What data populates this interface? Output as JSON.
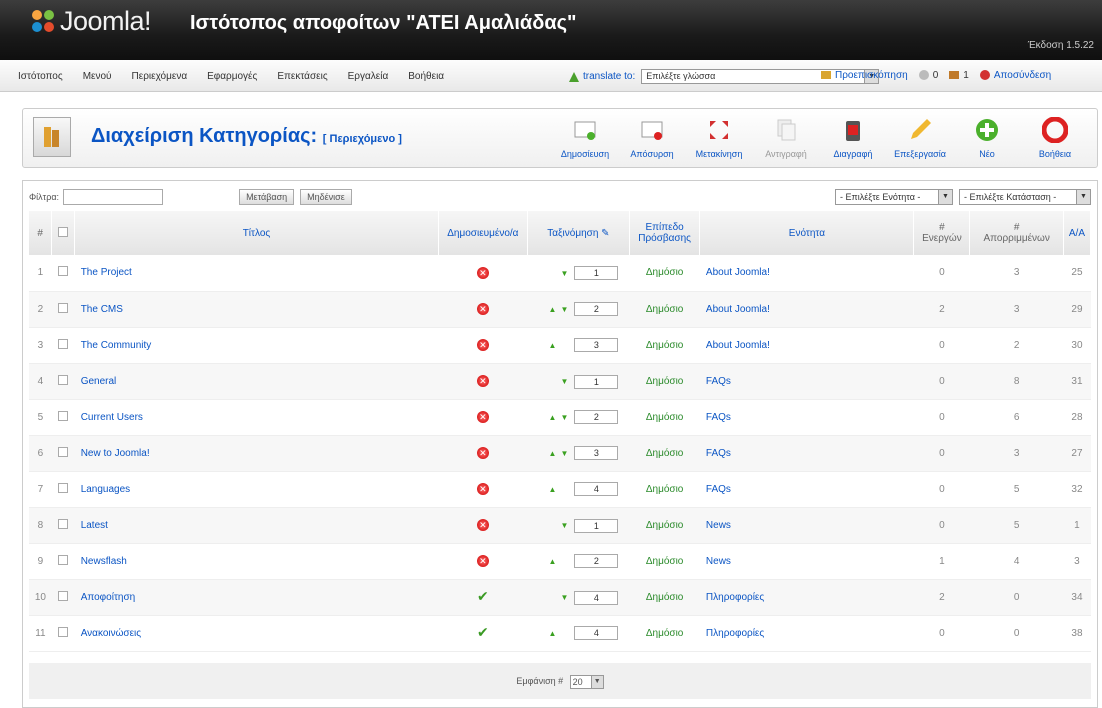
{
  "header": {
    "logo_text": "Joomla!",
    "site_title": "Ιστότοπος αποφοίτων \"ΑΤΕΙ Αμαλιάδας\"",
    "version": "Έκδοση 1.5.22"
  },
  "menu": {
    "items": [
      "Ιστότοπος",
      "Μενού",
      "Περιεχόμενα",
      "Εφαρμογές",
      "Επεκτάσεις",
      "Εργαλεία",
      "Βοήθεια"
    ],
    "translate_label": "translate to:",
    "translate_select": "Επιλέξτε γλώσσα",
    "preview": "Προεπισκόπηση",
    "messages_count": "0",
    "users_count": "1",
    "logout": "Αποσύνδεση"
  },
  "toolbar": {
    "title": "Διαχείριση Κατηγορίας:",
    "subtitle": "[ Περιεχόμενο ]",
    "buttons": {
      "publish": "Δημοσίευση",
      "unpublish": "Απόσυρση",
      "move": "Μετακίνηση",
      "copy": "Αντιγραφή",
      "delete": "Διαγραφή",
      "edit": "Επεξεργασία",
      "new": "Νέο",
      "help": "Βοήθεια"
    }
  },
  "filter": {
    "label": "Φίλτρα:",
    "value": "",
    "go": "Μετάβαση",
    "reset": "Μηδένισε",
    "section_select": "- Επιλέξτε Ενότητα -",
    "state_select": "- Επιλέξτε Κατάσταση -"
  },
  "table": {
    "headers": {
      "num": "#",
      "title": "Τίτλος",
      "published": "Δημοσιευμένο/α",
      "order": "Ταξινόμηση",
      "access": "Επίπεδο Πρόσβασης",
      "section": "Ενότητα",
      "active_hash": "#",
      "active": "Ενεργών",
      "trash_hash": "#",
      "trash": "Απορριμμένων",
      "id": "Α/Α"
    },
    "rows": [
      {
        "n": "1",
        "title": "The Project",
        "pub": "no",
        "up": "",
        "down": "▼",
        "order": "1",
        "access": "Δημόσιο",
        "section": "About Joomla!",
        "active": "0",
        "trash": "3",
        "id": "25"
      },
      {
        "n": "2",
        "title": "The CMS",
        "pub": "no",
        "up": "▲",
        "down": "▼",
        "order": "2",
        "access": "Δημόσιο",
        "section": "About Joomla!",
        "active": "2",
        "trash": "3",
        "id": "29"
      },
      {
        "n": "3",
        "title": "The Community",
        "pub": "no",
        "up": "▲",
        "down": "",
        "order": "3",
        "access": "Δημόσιο",
        "section": "About Joomla!",
        "active": "0",
        "trash": "2",
        "id": "30"
      },
      {
        "n": "4",
        "title": "General",
        "pub": "no",
        "up": "",
        "down": "▼",
        "order": "1",
        "access": "Δημόσιο",
        "section": "FAQs",
        "active": "0",
        "trash": "8",
        "id": "31"
      },
      {
        "n": "5",
        "title": "Current Users",
        "pub": "no",
        "up": "▲",
        "down": "▼",
        "order": "2",
        "access": "Δημόσιο",
        "section": "FAQs",
        "active": "0",
        "trash": "6",
        "id": "28"
      },
      {
        "n": "6",
        "title": "New to Joomla!",
        "pub": "no",
        "up": "▲",
        "down": "▼",
        "order": "3",
        "access": "Δημόσιο",
        "section": "FAQs",
        "active": "0",
        "trash": "3",
        "id": "27"
      },
      {
        "n": "7",
        "title": "Languages",
        "pub": "no",
        "up": "▲",
        "down": "",
        "order": "4",
        "access": "Δημόσιο",
        "section": "FAQs",
        "active": "0",
        "trash": "5",
        "id": "32"
      },
      {
        "n": "8",
        "title": "Latest",
        "pub": "no",
        "up": "",
        "down": "▼",
        "order": "1",
        "access": "Δημόσιο",
        "section": "News",
        "active": "0",
        "trash": "5",
        "id": "1"
      },
      {
        "n": "9",
        "title": "Newsflash",
        "pub": "no",
        "up": "▲",
        "down": "",
        "order": "2",
        "access": "Δημόσιο",
        "section": "News",
        "active": "1",
        "trash": "4",
        "id": "3"
      },
      {
        "n": "10",
        "title": "Αποφοίτηση",
        "pub": "yes",
        "up": "",
        "down": "▼",
        "order": "4",
        "access": "Δημόσιο",
        "section": "Πληροφορίες",
        "active": "2",
        "trash": "0",
        "id": "34"
      },
      {
        "n": "11",
        "title": "Ανακοινώσεις",
        "pub": "yes",
        "up": "▲",
        "down": "",
        "order": "4",
        "access": "Δημόσιο",
        "section": "Πληροφορίες",
        "active": "0",
        "trash": "0",
        "id": "38"
      }
    ]
  },
  "footer": {
    "display_label": "Εμφάνιση #",
    "display_value": "20"
  },
  "colors": {
    "accent": "#0b55c4",
    "published_green": "#3a9a24",
    "unpublished_red": "#cc0000"
  }
}
